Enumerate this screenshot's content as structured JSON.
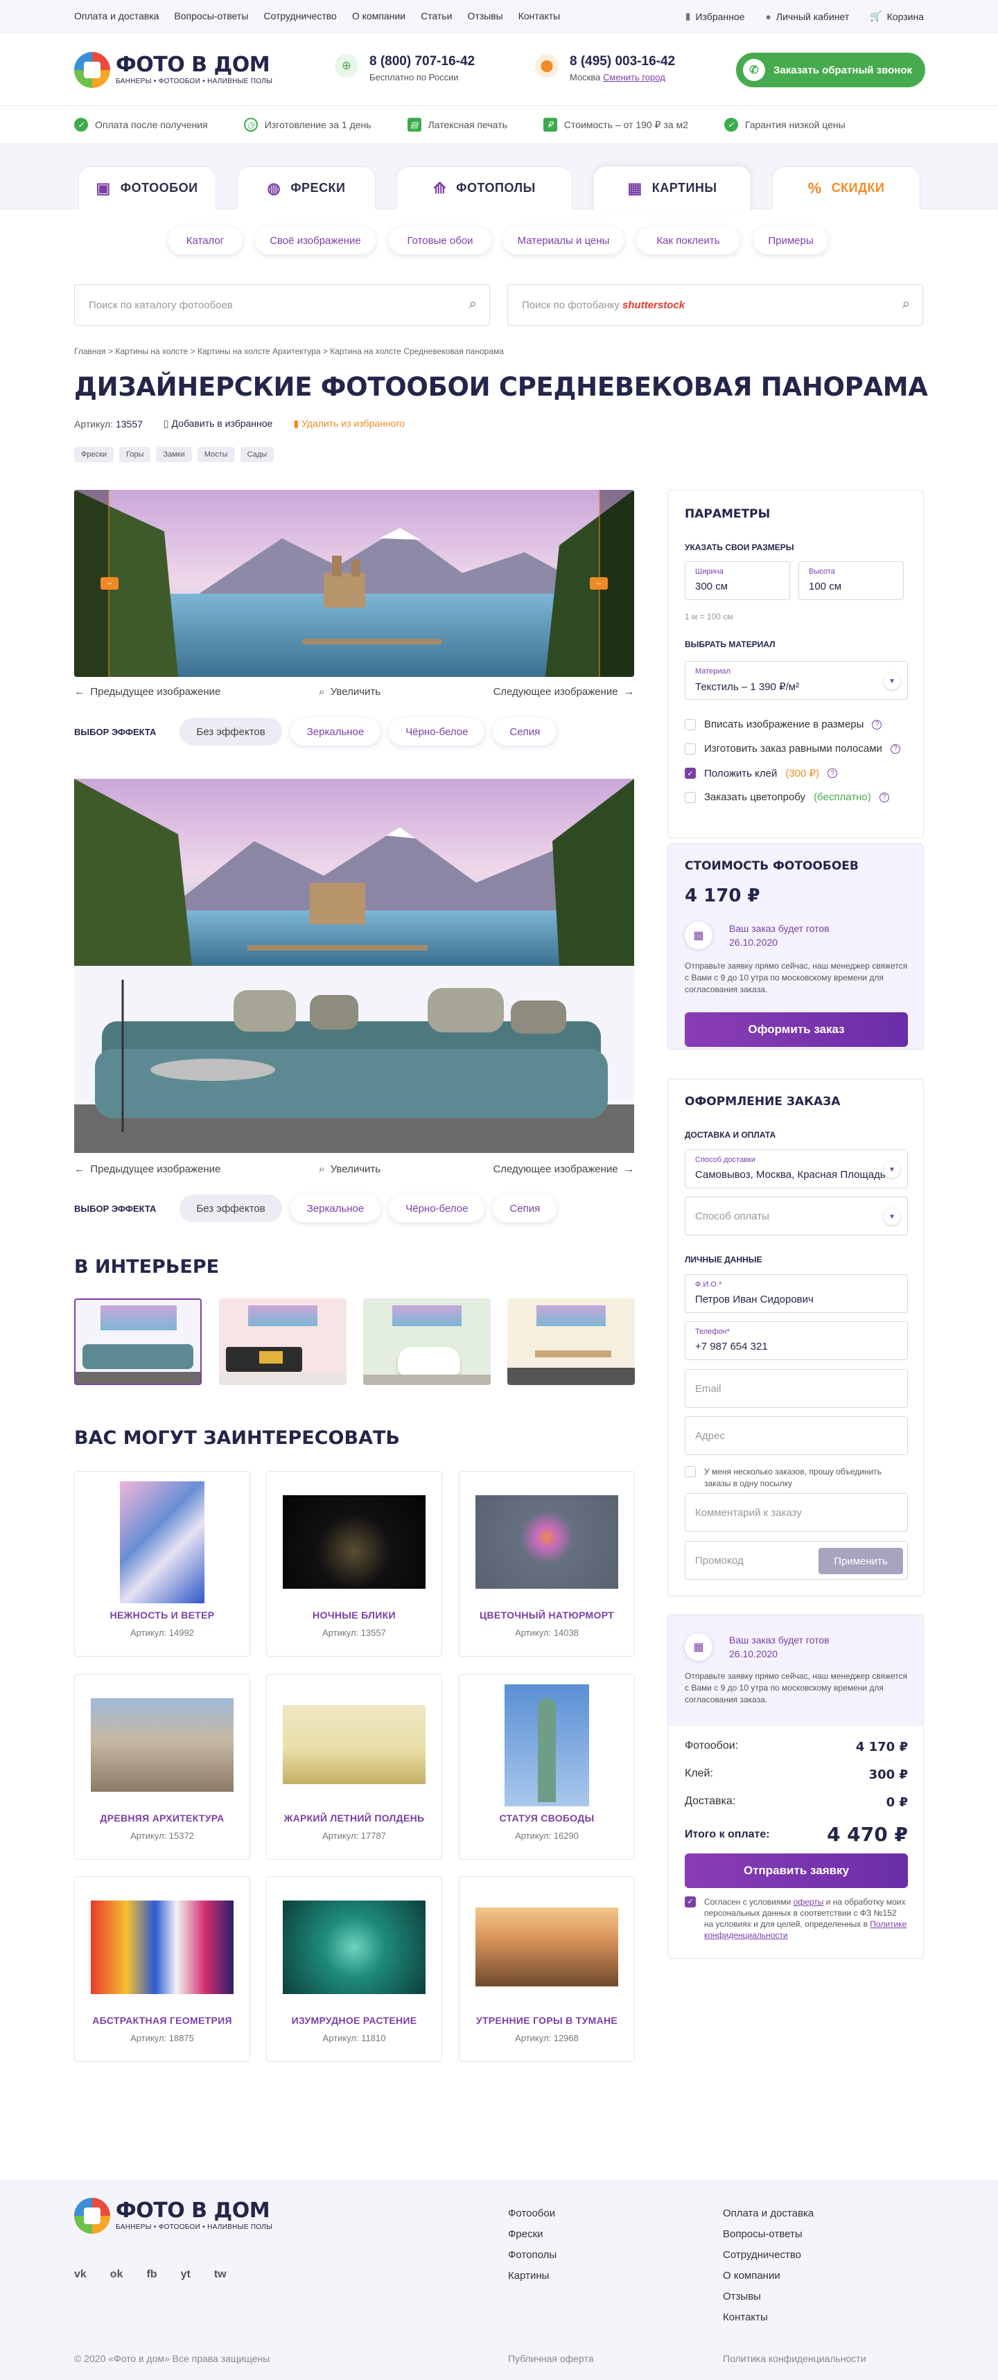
{
  "topbar": {
    "links": [
      "Оплата и доставка",
      "Вопросы-ответы",
      "Сотрудничество",
      "О компании",
      "Статьи",
      "Отзывы",
      "Контакты"
    ],
    "favorites": "Избранное",
    "account": "Личный кабинет",
    "cart": "Корзина"
  },
  "header": {
    "logo_title": "ФОТО В ДОМ",
    "logo_subtitle": "БАННЕРЫ • ФОТООБОИ • НАЛИВНЫЕ ПОЛЫ",
    "phone1": "8 (800) 707-16-42",
    "phone1_sub": "Бесплатно по России",
    "phone2": "8 (495) 003-16-42",
    "city": "Москва",
    "city_change": "Сменить город",
    "callback": "Заказать обратный звонок"
  },
  "features": [
    "Оплата после получения",
    "Изготовление за 1 день",
    "Латексная печать",
    "Стоимость – от 190 ₽ за м2",
    "Гарантия низкой цены"
  ],
  "tabs": [
    "ФОТООБОИ",
    "ФРЕСКИ",
    "ФОТОПОЛЫ",
    "КАРТИНЫ",
    "СКИДКИ"
  ],
  "subnav": [
    "Каталог",
    "Своё изображение",
    "Готовые обои",
    "Материалы и цены",
    "Как поклеить",
    "Примеры"
  ],
  "search": {
    "catalog_placeholder": "Поиск по каталогу фотообоев",
    "photobank_placeholder": "Поиск по фотобанку",
    "photobank_brand": "shutterstock"
  },
  "breadcrumbs": [
    "Главная",
    "Картины на холсте",
    "Картины на холсте Архитектура",
    "Картина на холсте Средневековая панорама"
  ],
  "product": {
    "title": "Дизайнерские фотообои Средневековая панорама",
    "article_label": "Артикул:",
    "article": "13557",
    "add_fav": "Добавить в избранное",
    "remove_fav": "Удалить из избранного",
    "tags": [
      "Фрески",
      "Горы",
      "Замки",
      "Мосты",
      "Сады"
    ]
  },
  "viewer": {
    "prev": "Предыдущее изображение",
    "zoom": "Увеличить",
    "next": "Следующее изображение",
    "effects_label": "ВЫБОР ЭФФЕКТА",
    "effects": [
      "Без эффектов",
      "Зеркальное",
      "Чёрно-белое",
      "Сепия"
    ]
  },
  "interior": {
    "title": "В ИНТЕРЬЕРЕ"
  },
  "related": {
    "title": "ВАС МОГУТ ЗАИНТЕРЕСОВАТЬ",
    "article_label": "Артикул:",
    "items": [
      {
        "name": "Нежность и ветер",
        "article": "14992"
      },
      {
        "name": "Ночные блики",
        "article": "13557"
      },
      {
        "name": "Цветочный натюрморт",
        "article": "14038"
      },
      {
        "name": "Древняя архитектура",
        "article": "15372"
      },
      {
        "name": "Жаркий летний полдень",
        "article": "17787"
      },
      {
        "name": "Статуя свободы",
        "article": "16290"
      },
      {
        "name": "Абстрактная геометрия",
        "article": "18875"
      },
      {
        "name": "Изумрудное растение",
        "article": "11810"
      },
      {
        "name": "Утренние горы в тумане",
        "article": "12968"
      }
    ]
  },
  "params": {
    "title": "ПАРАМЕТРЫ",
    "size_label": "УКАЗАТЬ СВОИ РАЗМЕРЫ",
    "width_label": "Ширина",
    "width_value": "300 см",
    "height_label": "Высота",
    "height_value": "100 см",
    "unit_note": "1 м = 100 см",
    "material_section": "ВЫБРАТЬ МАТЕРИАЛ",
    "material_label": "Материал",
    "material_value": "Текстиль – 1 390 ₽/м²",
    "opt1": "Вписать изображение в размеры",
    "opt2": "Изготовить заказ равными полосами",
    "opt3": "Положить клей",
    "opt3_price": "(300 ₽)",
    "opt4": "Заказать цветопробу",
    "opt4_free": "(бесплатно)"
  },
  "cost": {
    "title": "СТОИМОСТЬ ФОТООБОЕВ",
    "price": "4 170 ₽",
    "ready_label": "Ваш заказ будет готов",
    "ready_date": "26.10.2020",
    "note": "Отправьте заявку прямо сейчас, наш менеджер свяжется с Вами с 9 до 10 утра по московскому времени для согласования заказа.",
    "button": "Оформить заказ"
  },
  "order": {
    "title": "ОФОРМЛЕНИЕ ЗАКАЗА",
    "delivery_section": "ДОСТАВКА И ОПЛАТА",
    "delivery_label": "Способ доставки",
    "delivery_value": "Самовывоз, Москва, Красная Площадь",
    "payment_placeholder": "Способ оплаты",
    "personal_section": "ЛИЧНЫЕ ДАННЫЕ",
    "name_label": "Ф.И.О.*",
    "name_value": "Петров Иван Сидорович",
    "phone_label": "Телефон*",
    "phone_value": "+7 987 654 321",
    "email_placeholder": "Email",
    "address_placeholder": "Адрес",
    "combine": "У меня несколько заказов, прошу объединить заказы в одну посылку",
    "comment_placeholder": "Комментарий к заказу",
    "promo_placeholder": "Промокод",
    "apply": "Применить"
  },
  "summary": {
    "ready_label": "Ваш заказ будет готов",
    "ready_date": "26.10.2020",
    "note": "Отправьте заявку прямо сейчас, наш менеджер свяжется с Вами с 9 до 10 утра по московскому времени для согласования заказа.",
    "rows": [
      {
        "label": "Фотообои:",
        "value": "4 170 ₽"
      },
      {
        "label": "Клей:",
        "value": "300 ₽"
      },
      {
        "label": "Доставка:",
        "value": "0 ₽"
      }
    ],
    "total_label": "Итого к оплате:",
    "total": "4 470 ₽",
    "submit": "Отправить заявку",
    "consent_1": "Согласен с условиями",
    "consent_link1": "оферты",
    "consent_2": "и на обработку моих персональных данных в соответствии с ФЗ №152 на условиях и для целей, определенных в",
    "consent_link2": "Политике конфиденциальности"
  },
  "footer": {
    "col1": [
      "Фотообои",
      "Фрески",
      "Фотополы",
      "Картины"
    ],
    "col2": [
      "Оплата и доставка",
      "Вопросы-ответы",
      "Сотрудничество",
      "О компании",
      "Отзывы",
      "Контакты"
    ],
    "social": [
      "vk",
      "ok",
      "fb",
      "yt",
      "tw"
    ],
    "copyright": "© 2020 «Фото в дом» Все права защищены",
    "offer": "Публичная оферта",
    "privacy": "Политика конфиденциальности"
  },
  "colors": {
    "accent": "#7b3fa6",
    "green": "#46ab4e",
    "orange": "#f08a24",
    "dark": "#23264a"
  }
}
